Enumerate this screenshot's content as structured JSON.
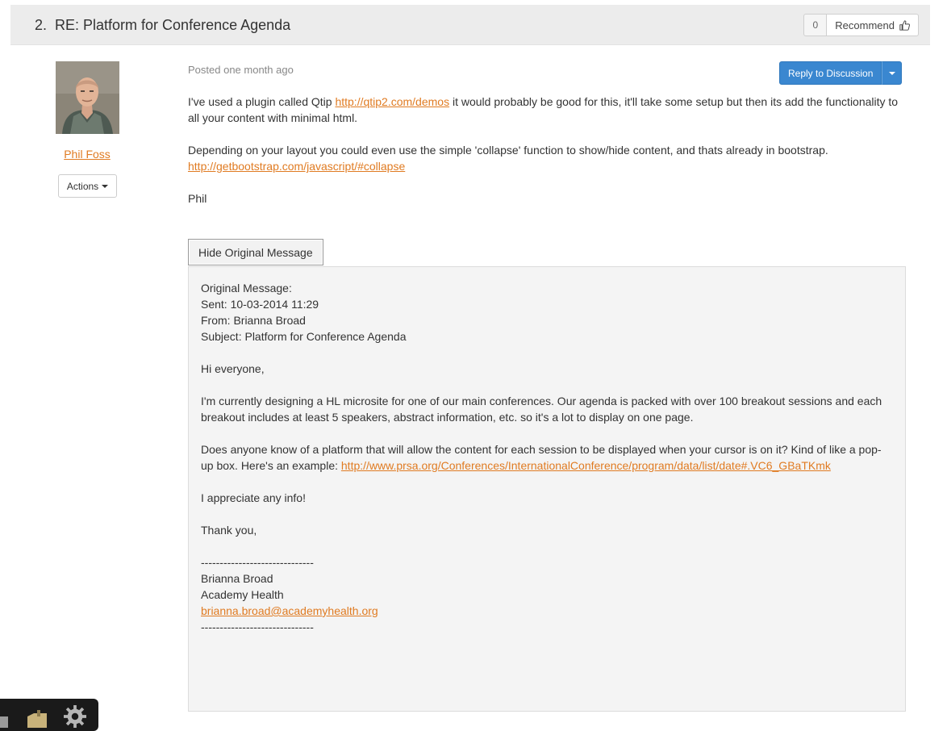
{
  "header": {
    "number": "2.",
    "title": "RE: Platform for Conference Agenda",
    "recommend_count": "0",
    "recommend_label": "Recommend"
  },
  "author": {
    "name": "Phil Foss",
    "actions_label": "Actions"
  },
  "post": {
    "posted": "Posted one month ago",
    "reply_label": "Reply to Discussion",
    "p1_before": "I've used a plugin called Qtip ",
    "p1_link": "http://qtip2.com/demos",
    "p1_after": " it would probably be good for this, it'll take some setup but then its add the functionality to all your content with minimal html.",
    "p2_text": "Depending on your layout you could even use the simple 'collapse' function to show/hide content, and thats already in bootstrap.",
    "p2_link": "http://getbootstrap.com/javascript/#collapse",
    "signoff": "Phil",
    "hide_label": "Hide Original Message"
  },
  "original": {
    "heading": "Original Message:",
    "sent": "Sent: 10-03-2014 11:29",
    "from": "From: Brianna Broad",
    "subject": "Subject: Platform for Conference Agenda",
    "greeting": "Hi everyone,",
    "para1": "I'm currently designing a HL microsite for one of our main conferences. Our agenda is packed with over 100 breakout sessions and each breakout includes at least 5 speakers, abstract information, etc. so it's a lot to display on one page.",
    "para2_text": "Does anyone know of a platform that will allow the content for each session to be displayed when your cursor is on it? Kind of like a pop-up box. Here's an example: ",
    "para2_link": "http://www.prsa.org/Conferences/InternationalConference/program/data/list/date#.VC6_GBaTKmk",
    "appreciate": "I appreciate any info!",
    "thanks": "Thank you,",
    "divider": "------------------------------",
    "sig_name": "Brianna Broad",
    "sig_org": "Academy Health",
    "sig_email": "brianna.broad@academyhealth.org"
  },
  "colors": {
    "link": "#e07b22",
    "primary_button": "#3a87d0",
    "header_bg": "#ececec",
    "quote_bg": "#f4f4f4"
  },
  "icons": [
    "thumbs-up-icon",
    "caret-down-icon",
    "folder-icon",
    "gear-icon",
    "avatar-photo"
  ]
}
